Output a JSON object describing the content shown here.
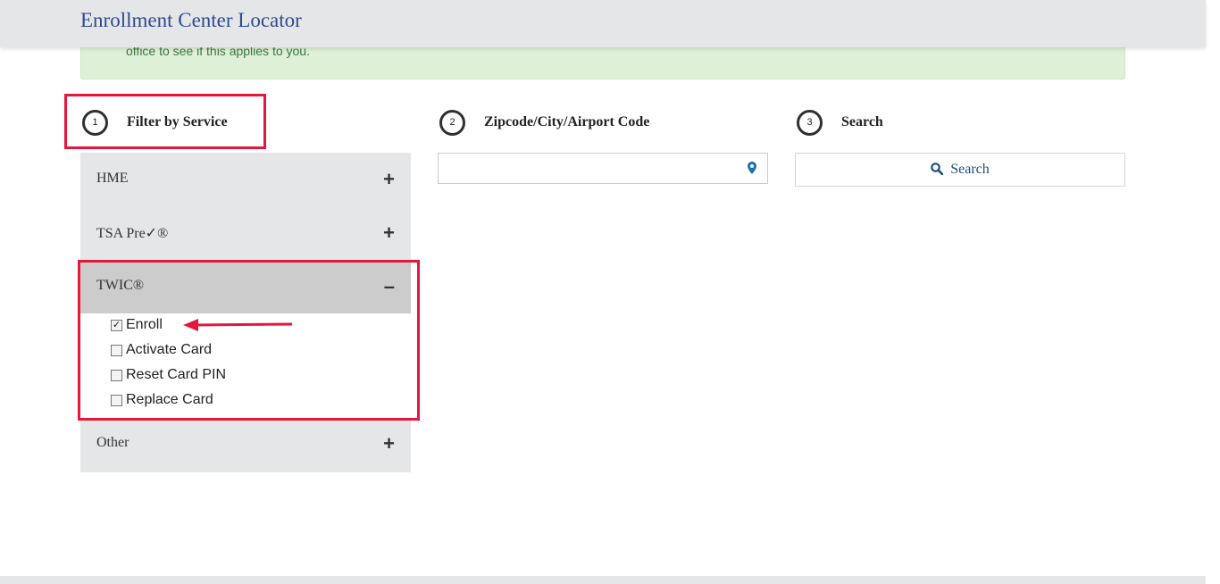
{
  "header": {
    "title": "Enrollment Center Locator"
  },
  "alert": {
    "text": "office to see if this applies to you."
  },
  "steps": [
    {
      "number": "1",
      "label": "Filter by Service"
    },
    {
      "number": "2",
      "label": "Zipcode/City/Airport Code"
    },
    {
      "number": "3",
      "label": "Search"
    }
  ],
  "services": {
    "hme": {
      "label": "HME",
      "toggle": "+"
    },
    "tsa": {
      "label": "TSA Pre✓®",
      "toggle": "+"
    },
    "twic": {
      "label": "TWIC®",
      "toggle": "–",
      "options": [
        {
          "label": "Enroll",
          "checked": true
        },
        {
          "label": "Activate Card",
          "checked": false
        },
        {
          "label": "Reset Card PIN",
          "checked": false
        },
        {
          "label": "Replace Card",
          "checked": false
        }
      ]
    },
    "other": {
      "label": "Other",
      "toggle": "+"
    }
  },
  "location": {
    "value": "",
    "icon": "map-pin-icon"
  },
  "search_button": {
    "label": "Search",
    "icon": "search-icon"
  },
  "colors": {
    "header_bg": "#e5e6e8",
    "title": "#2e4b8e",
    "alert_bg": "#dff0d8",
    "alert_text": "#3c763d",
    "highlight": "#e4173e",
    "accent_blue": "#1f4f7a"
  }
}
